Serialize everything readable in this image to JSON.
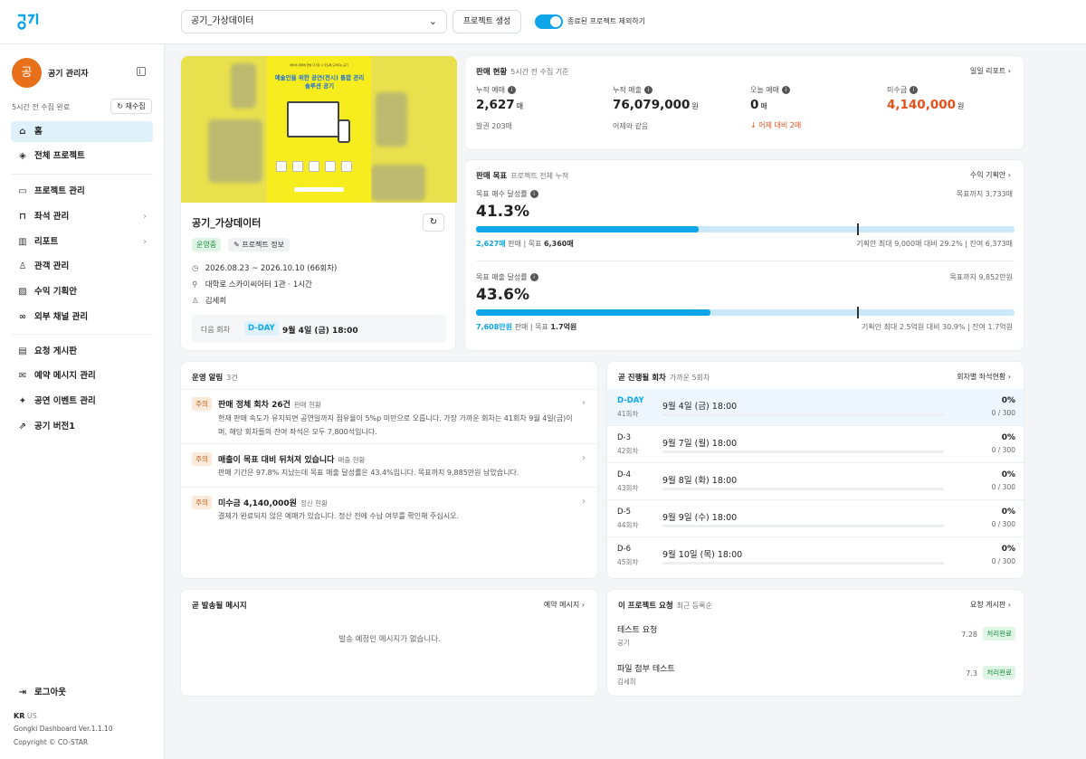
{
  "topbar": {
    "project_select_value": "공기_가상데이터",
    "create_button_label": "프로젝트 생성",
    "toggle_label": "종료된 프로젝트 제외하기",
    "toggle_on": true
  },
  "sidebar": {
    "avatar_initial": "공",
    "admin_name": "공기 관리자",
    "collect_status": "5시간 전 수집 완료",
    "recollect_label": "재수집",
    "items": [
      {
        "label": "홈",
        "icon": "home-icon",
        "active": true
      },
      {
        "label": "전체 프로젝트",
        "icon": "layers-icon"
      },
      {
        "label": "프로젝트 관리",
        "icon": "folder-icon"
      },
      {
        "label": "좌석 관리",
        "icon": "seat-icon"
      },
      {
        "label": "리포트",
        "icon": "chart-icon"
      },
      {
        "label": "관객 관리",
        "icon": "user-icon"
      },
      {
        "label": "수익 기획안",
        "icon": "plan-icon"
      },
      {
        "label": "외부 채널 관리",
        "icon": "link-icon"
      },
      {
        "label": "요청 게시판",
        "icon": "inbox-icon"
      },
      {
        "label": "예약 메시지 관리",
        "icon": "message-icon"
      },
      {
        "label": "공연 이벤트 관리",
        "icon": "party-icon"
      },
      {
        "label": "공기 버전1",
        "icon": "external-link-icon"
      }
    ],
    "logout_label": "로그아웃",
    "lang_active": "KR",
    "lang_other": "US",
    "version": "Gongki Dashboard Ver.1.1.10",
    "copyright": "Copyright © CO-STAR"
  },
  "project": {
    "title": "공기_가상데이터",
    "status_badge": "운영중",
    "info_button": "프로젝트 정보",
    "period": "2026.08.23 ~ 2026.10.10 (66회차)",
    "venue": "대학로 스카이씨어터 1관 · 1시간",
    "manager": "김세희",
    "next_label": "다음 회차",
    "next_dday": "D-DAY",
    "next_date": "9월 4일 (금) 18:00",
    "poster_top": "예술의 세계에 한발 다가갈 수 있도록 도와주는 공기",
    "poster_headline": "예술인을 위한 공연(전시) 통합 관리 솔루션 공기"
  },
  "sales_status": {
    "title": "판매 현황",
    "subtitle": "5시간 전 수집 기준",
    "link": "일일 리포트",
    "cumulative_reservations_label": "누적 예매",
    "cumulative_reservations_value": "2,627",
    "cumulative_reservations_unit": "매",
    "issued": "발권 203매",
    "cumulative_sales_label": "누적 매출",
    "cumulative_sales_value": "76,079,000",
    "cumulative_sales_unit": "원",
    "sales_sub": "어제와 같음",
    "today_label": "오늘 예매",
    "today_value": "0",
    "today_unit": "매",
    "today_sub": "↓ 어제 대비 2매",
    "unpaid_label": "미수금",
    "unpaid_value": "4,140,000",
    "unpaid_unit": "원"
  },
  "sales_goal": {
    "title": "판매 목표",
    "subtitle": "프로젝트 전체 누적",
    "link": "수익 기획안",
    "qty_label": "목표 매수 달성률",
    "qty_remaining": "목표까지 3,733매",
    "qty_pct": "41.3%",
    "qty_progress": 0.413,
    "qty_marker": 0.707,
    "qty_sold": "2,627매",
    "qty_sold_suffix": "판매",
    "qty_goal_label": "목표",
    "qty_goal": "6,360매",
    "qty_plan": "기획안 최대 9,000매 대비 29.2%",
    "qty_rest": "잔여 6,373매",
    "rev_label": "목표 매출 달성률",
    "rev_remaining": "목표까지 9,852만원",
    "rev_pct": "43.6%",
    "rev_progress": 0.436,
    "rev_marker": 0.707,
    "rev_sold": "7,608만원",
    "rev_sold_suffix": "판매",
    "rev_goal_label": "목표",
    "rev_goal": "1.7억원",
    "rev_plan": "기획안 최대 2.5억원 대비 30.9%",
    "rev_rest": "잔여 1.7억원"
  },
  "alerts": {
    "title": "운영 알림",
    "count": "3건",
    "items": [
      {
        "tag": "주의",
        "title": "판매 정체 회차 26건",
        "source": "판매 현황",
        "desc": "현재 판매 속도가 유지되면 공연일까지 점유율이 5%p 미만으로 오릅니다. 가장 가까운 회차는 41회차 9월 4일(금)이며, 해당 회차들의 잔여 좌석은 모두 7,800석입니다."
      },
      {
        "tag": "주의",
        "title": "매출이 목표 대비 뒤처져 있습니다",
        "source": "매출 현황",
        "desc": "판매 기간은 97.8% 지났는데 목표 매출 달성률은 43.4%입니다. 목표까지 9,885만원 남았습니다."
      },
      {
        "tag": "주의",
        "title": "미수금 4,140,000원",
        "source": "정산 현황",
        "desc": "결제가 완료되지 않은 예매가 있습니다. 정산 전에 수납 여부를 확인해 주십시오."
      }
    ]
  },
  "sessions": {
    "title": "곧 진행될 회차",
    "subtitle": "가까운 5회차",
    "link": "회차별 좌석현황",
    "items": [
      {
        "dday": "D-DAY",
        "no": "41회차",
        "date": "9월 4일 (금) 18:00",
        "pct": "0%",
        "count": "0 / 300"
      },
      {
        "dday": "D-3",
        "no": "42회차",
        "date": "9월 7일 (월) 18:00",
        "pct": "0%",
        "count": "0 / 300"
      },
      {
        "dday": "D-4",
        "no": "43회차",
        "date": "9월 8일 (화) 18:00",
        "pct": "0%",
        "count": "0 / 300"
      },
      {
        "dday": "D-5",
        "no": "44회차",
        "date": "9월 9일 (수) 18:00",
        "pct": "0%",
        "count": "0 / 300"
      },
      {
        "dday": "D-6",
        "no": "45회차",
        "date": "9월 10일 (목) 18:00",
        "pct": "0%",
        "count": "0 / 300"
      }
    ]
  },
  "messages": {
    "title": "곧 발송될 메시지",
    "link": "예약 메시지",
    "empty": "발송 예정인 메시지가 없습니다."
  },
  "requests": {
    "title": "이 프로젝트 요청",
    "subtitle": "최근 등록순",
    "link": "요청 게시판",
    "items": [
      {
        "title": "테스트 요청",
        "author": "공기",
        "date": "7.28",
        "status": "처리완료"
      },
      {
        "title": "파일 첨부 테스트",
        "author": "김세희",
        "date": "7.3",
        "status": "처리완료"
      }
    ]
  },
  "colors": {
    "accent": "#0ea5e9",
    "warning": "#e8501a",
    "avatar": "#e8701a",
    "poster": "#f7ec1d"
  }
}
